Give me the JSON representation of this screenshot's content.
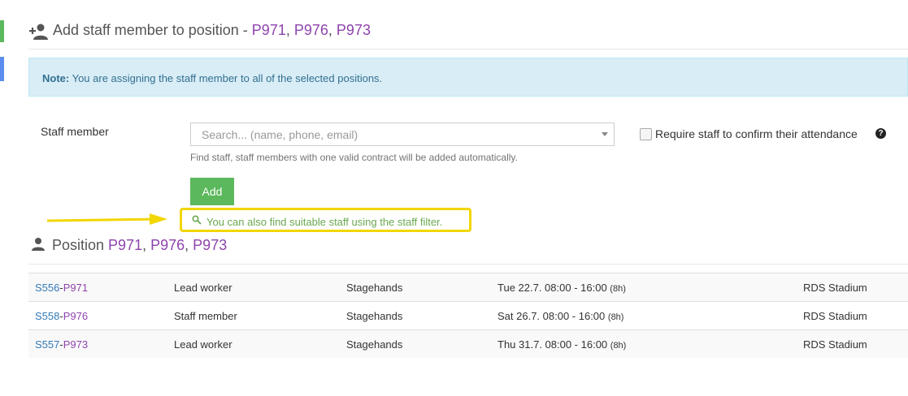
{
  "header": {
    "title_prefix": "Add staff member to position - ",
    "positions": [
      "P971",
      "P976",
      "P973"
    ],
    "separator": ", "
  },
  "note": {
    "bold": "Note:",
    "text": " You are assigning the staff member to all of the selected positions."
  },
  "form": {
    "staff_label": "Staff member",
    "search_placeholder": "Search... (name, phone, email)",
    "search_value": "",
    "help_text": "Find staff, staff members with one valid contract will be added automatically.",
    "confirm_label": "Require staff to confirm their attendance",
    "confirm_checked": false,
    "add_label": "Add",
    "hint": "You can also find suitable staff using the staff filter."
  },
  "position_section": {
    "title_prefix": "Position ",
    "positions": [
      "P971",
      "P976",
      "P973"
    ]
  },
  "rows": [
    {
      "shift": "S556",
      "sep": "-",
      "position": "P971",
      "role": "Lead worker",
      "group": "Stagehands",
      "time": "Tue 22.7. 08:00 - 16:00",
      "hours": "(8h)",
      "venue": "RDS Stadium"
    },
    {
      "shift": "S558",
      "sep": "-",
      "position": "P976",
      "role": "Staff member",
      "group": "Stagehands",
      "time": "Sat 26.7. 08:00 - 16:00",
      "hours": "(8h)",
      "venue": "RDS Stadium"
    },
    {
      "shift": "S557",
      "sep": "-",
      "position": "P973",
      "role": "Lead worker",
      "group": "Stagehands",
      "time": "Thu 31.7. 08:00 - 16:00",
      "hours": "(8h)",
      "venue": "RDS Stadium"
    }
  ],
  "colors": {
    "accent_green": "#5cb85c",
    "accent_blue": "#5b8def",
    "position_purple": "#8e44ad",
    "highlight_yellow": "#f2d600",
    "note_bg": "#d9edf7"
  },
  "icons": {
    "header": "add-person-icon",
    "position": "person-icon",
    "hint": "search-icon",
    "help": "question-circle-icon"
  }
}
